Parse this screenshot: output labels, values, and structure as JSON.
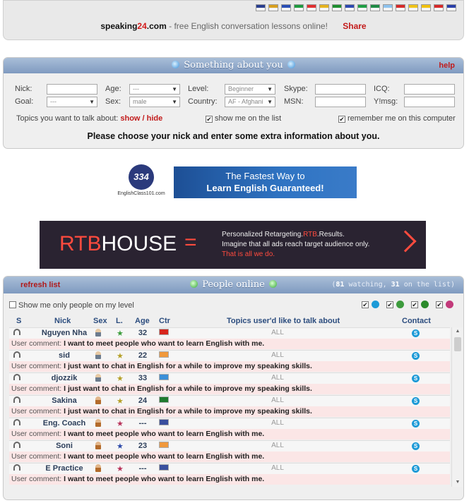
{
  "header": {
    "flags": [
      {
        "name": "uk-flag-icon",
        "color": "#2a3f8f"
      },
      {
        "name": "de-flag-icon",
        "color": "#d8a020"
      },
      {
        "name": "ru-flag-icon",
        "color": "#2b4fb5"
      },
      {
        "name": "it-flag-icon",
        "color": "#1f9a3f"
      },
      {
        "name": "pl-flag-icon",
        "color": "#e03030"
      },
      {
        "name": "es-flag-icon",
        "color": "#e6b420"
      },
      {
        "name": "pt-flag-icon",
        "color": "#1e8f2f"
      },
      {
        "name": "fr-flag-icon",
        "color": "#2d49b0"
      },
      {
        "name": "br-flag-icon",
        "color": "#1f9e45"
      },
      {
        "name": "mx-flag-icon",
        "color": "#1f8a45"
      },
      {
        "name": "ar-flag-icon",
        "color": "#8fc3ee"
      },
      {
        "name": "pe-flag-icon",
        "color": "#d62a2a"
      },
      {
        "name": "co-flag-icon",
        "color": "#f0c419"
      },
      {
        "name": "ve-flag-icon",
        "color": "#f2c20e"
      },
      {
        "name": "cl-flag-icon",
        "color": "#d62a2a"
      },
      {
        "name": "cr-flag-icon",
        "color": "#2a3fa8"
      }
    ],
    "brand_main": "speaking",
    "brand_num": "24",
    "brand_tld": ".com",
    "tagline": " - free English conversation lessons online!",
    "share_label": "Share"
  },
  "about": {
    "title": "Something about you",
    "help_label": "help",
    "nick_label": "Nick:",
    "age_label": "Age:",
    "age_value": "---",
    "level_label": "Level:",
    "level_value": "Beginner",
    "skype_label": "Skype:",
    "icq_label": "ICQ:",
    "goal_label": "Goal:",
    "goal_value": "---",
    "sex_label": "Sex:",
    "sex_value": "male",
    "country_label": "Country:",
    "country_value": "AF - Afghani",
    "msn_label": "MSN:",
    "ymsg_label": "Y!msg:",
    "topics_label": "Topics you want to talk about:",
    "topics_link": "show / hide",
    "show_me_label": "show me on the list",
    "remember_label": "remember me on this computer",
    "check_mark": "✔",
    "message": "Please choose your nick and enter some extra information about you."
  },
  "ads": {
    "ec_logo_text": "334",
    "ec_name": "EnglishClass101.com",
    "ec_line1": "The Fastest Way to",
    "ec_line2": "Learn English Guaranteed!",
    "rtb_brand": "RTB",
    "rtb_house": "HOUSE",
    "rtb_eq": "=",
    "rtb_line1a": "Personalized Retargeting.",
    "rtb_line1b": "RTB",
    "rtb_line1c": ".Results.",
    "rtb_line2": "Imagine that all ads reach target audience only.",
    "rtb_line3": "That is all we do."
  },
  "people": {
    "refresh_label": "refresh list",
    "title": "People online",
    "watching_count": "81",
    "watching_label": "watching",
    "list_count": "31",
    "list_label": "on the list",
    "level_filter_label": "Show me only people on my level",
    "columns": {
      "s": "S",
      "nick": "Nick",
      "sex": "Sex",
      "level": "L.",
      "age": "Age",
      "ctr": "Ctr",
      "topics": "Topics user'd like to talk about",
      "contact": "Contact"
    },
    "comment_prefix": "User comment:",
    "skype_glyph": "S",
    "users": [
      {
        "nick": "Nguyen Nha",
        "sex": "m",
        "level": "1",
        "age": "32",
        "flag_color": "#d8261d",
        "topics": "ALL",
        "comment": "I want to meet people who want to learn English with me."
      },
      {
        "nick": "sid",
        "sex": "m",
        "level": "2",
        "age": "22",
        "flag_color": "#f0993c",
        "topics": "ALL",
        "comment": "I just want to chat in English for a while to improve my speaking skills."
      },
      {
        "nick": "djozzik",
        "sex": "m",
        "level": "2",
        "age": "33",
        "flag_color": "#3c8fd8",
        "topics": "ALL",
        "comment": "I just want to chat in English for a while to improve my speaking skills."
      },
      {
        "nick": "Sakina",
        "sex": "f",
        "level": "2",
        "age": "24",
        "flag_color": "#1f7a2f",
        "topics": "ALL",
        "comment": "I just want to chat in English for a while to improve my speaking skills."
      },
      {
        "nick": "Eng. Coach",
        "sex": "f",
        "level": "4",
        "age": "---",
        "flag_color": "#3a4f9e",
        "topics": "ALL",
        "comment": "I want to meet people who want to learn English with me."
      },
      {
        "nick": "Soni",
        "sex": "f",
        "level": "3",
        "age": "23",
        "flag_color": "#f0993c",
        "topics": "ALL",
        "comment": "I want to meet people who want to learn English with me."
      },
      {
        "nick": "E Practice",
        "sex": "f",
        "level": "4",
        "age": "---",
        "flag_color": "#3a4f9e",
        "topics": "ALL",
        "comment": "I want to meet people who want to learn English with me."
      }
    ]
  }
}
